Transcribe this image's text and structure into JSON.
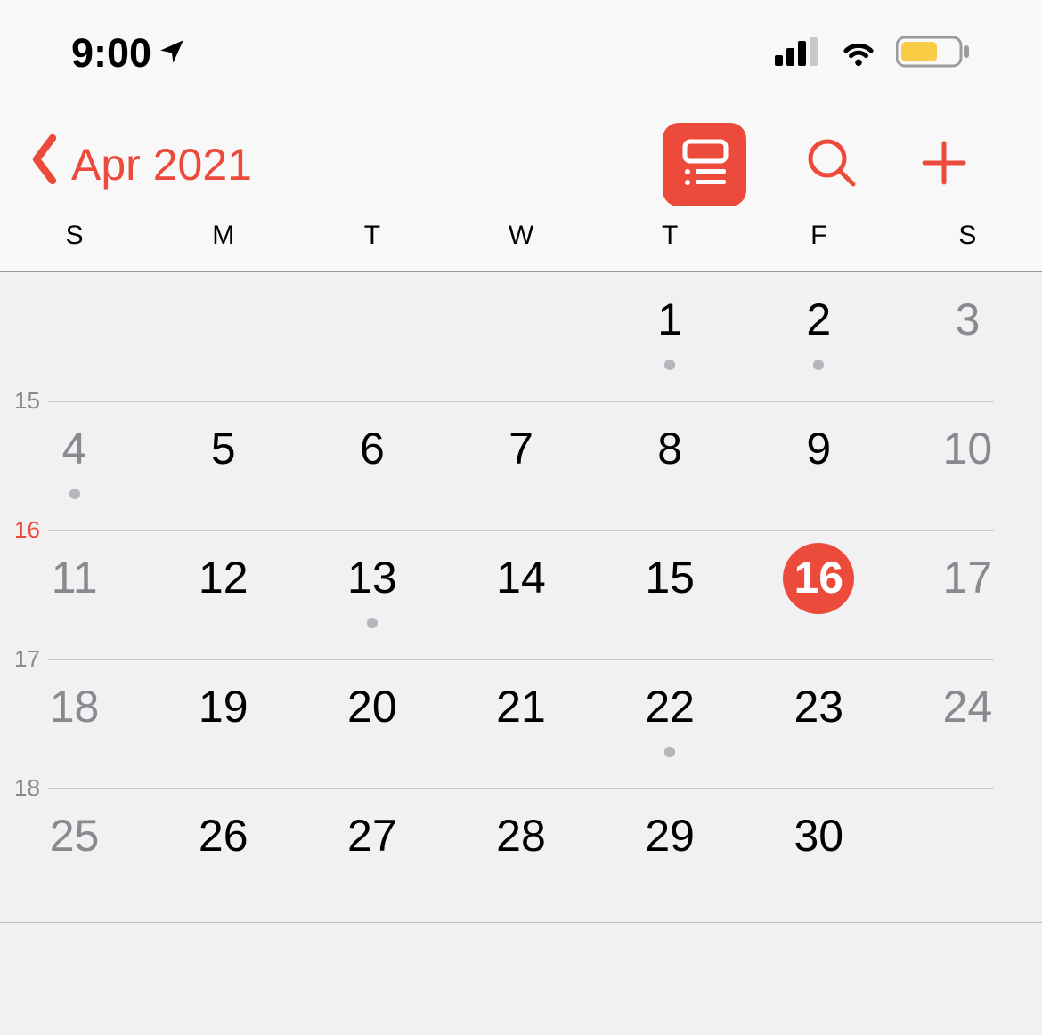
{
  "status": {
    "time": "9:00"
  },
  "nav": {
    "month_label": "Apr 2021"
  },
  "weekdays": [
    "S",
    "M",
    "T",
    "W",
    "T",
    "F",
    "S"
  ],
  "weeks": [
    {
      "num": "",
      "numToday": false,
      "days": [
        {
          "n": "",
          "weekend": true,
          "today": false,
          "dot": false
        },
        {
          "n": "",
          "weekend": false,
          "today": false,
          "dot": false
        },
        {
          "n": "",
          "weekend": false,
          "today": false,
          "dot": false
        },
        {
          "n": "",
          "weekend": false,
          "today": false,
          "dot": false
        },
        {
          "n": "1",
          "weekend": false,
          "today": false,
          "dot": true
        },
        {
          "n": "2",
          "weekend": false,
          "today": false,
          "dot": true
        },
        {
          "n": "3",
          "weekend": true,
          "today": false,
          "dot": false
        }
      ]
    },
    {
      "num": "15",
      "numToday": false,
      "days": [
        {
          "n": "4",
          "weekend": true,
          "today": false,
          "dot": true
        },
        {
          "n": "5",
          "weekend": false,
          "today": false,
          "dot": false
        },
        {
          "n": "6",
          "weekend": false,
          "today": false,
          "dot": false
        },
        {
          "n": "7",
          "weekend": false,
          "today": false,
          "dot": false
        },
        {
          "n": "8",
          "weekend": false,
          "today": false,
          "dot": false
        },
        {
          "n": "9",
          "weekend": false,
          "today": false,
          "dot": false
        },
        {
          "n": "10",
          "weekend": true,
          "today": false,
          "dot": false
        }
      ]
    },
    {
      "num": "16",
      "numToday": true,
      "days": [
        {
          "n": "11",
          "weekend": true,
          "today": false,
          "dot": false
        },
        {
          "n": "12",
          "weekend": false,
          "today": false,
          "dot": false
        },
        {
          "n": "13",
          "weekend": false,
          "today": false,
          "dot": true
        },
        {
          "n": "14",
          "weekend": false,
          "today": false,
          "dot": false
        },
        {
          "n": "15",
          "weekend": false,
          "today": false,
          "dot": false
        },
        {
          "n": "16",
          "weekend": false,
          "today": true,
          "dot": false
        },
        {
          "n": "17",
          "weekend": true,
          "today": false,
          "dot": false
        }
      ]
    },
    {
      "num": "17",
      "numToday": false,
      "days": [
        {
          "n": "18",
          "weekend": true,
          "today": false,
          "dot": false
        },
        {
          "n": "19",
          "weekend": false,
          "today": false,
          "dot": false
        },
        {
          "n": "20",
          "weekend": false,
          "today": false,
          "dot": false
        },
        {
          "n": "21",
          "weekend": false,
          "today": false,
          "dot": false
        },
        {
          "n": "22",
          "weekend": false,
          "today": false,
          "dot": true
        },
        {
          "n": "23",
          "weekend": false,
          "today": false,
          "dot": false
        },
        {
          "n": "24",
          "weekend": true,
          "today": false,
          "dot": false
        }
      ]
    },
    {
      "num": "18",
      "numToday": false,
      "days": [
        {
          "n": "25",
          "weekend": true,
          "today": false,
          "dot": false
        },
        {
          "n": "26",
          "weekend": false,
          "today": false,
          "dot": false
        },
        {
          "n": "27",
          "weekend": false,
          "today": false,
          "dot": false
        },
        {
          "n": "28",
          "weekend": false,
          "today": false,
          "dot": false
        },
        {
          "n": "29",
          "weekend": false,
          "today": false,
          "dot": false
        },
        {
          "n": "30",
          "weekend": false,
          "today": false,
          "dot": false
        },
        {
          "n": "",
          "weekend": true,
          "today": false,
          "dot": false
        }
      ]
    }
  ]
}
